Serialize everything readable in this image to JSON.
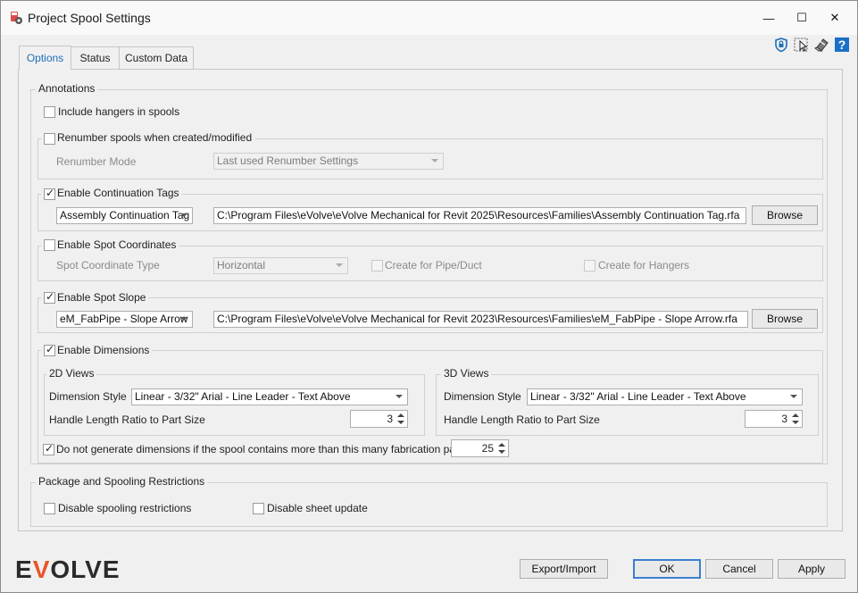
{
  "window": {
    "title": "Project Spool Settings",
    "minimize": "—",
    "maximize": "☐",
    "close": "✕"
  },
  "tabs": [
    {
      "label": "Options"
    },
    {
      "label": "Status"
    },
    {
      "label": "Custom Data"
    }
  ],
  "annotations": {
    "legend": "Annotations",
    "include_hangers": {
      "label": "Include hangers in spools",
      "checked": false
    },
    "renumber": {
      "label": "Renumber spools when created/modified",
      "checked": false,
      "mode_label": "Renumber Mode",
      "mode_value": "Last used Renumber Settings"
    },
    "continuation": {
      "label": "Enable Continuation Tags",
      "checked": true,
      "family_value": "Assembly Continuation Tag",
      "path": "C:\\Program Files\\eVolve\\eVolve Mechanical for Revit 2025\\Resources\\Families\\Assembly Continuation Tag.rfa",
      "browse": "Browse"
    },
    "spot_coordinates": {
      "label": "Enable Spot Coordinates",
      "checked": false,
      "type_label": "Spot Coordinate Type",
      "type_value": "Horizontal",
      "pipe_duct_label": "Create for Pipe/Duct",
      "hangers_label": "Create for Hangers"
    },
    "spot_slope": {
      "label": "Enable Spot Slope",
      "checked": true,
      "family_value": "eM_FabPipe - Slope Arrow",
      "path": "C:\\Program Files\\eVolve\\eVolve Mechanical for Revit 2023\\Resources\\Families\\eM_FabPipe - Slope Arrow.rfa",
      "browse": "Browse"
    },
    "dimensions": {
      "label": "Enable Dimensions",
      "checked": true,
      "views_2d": {
        "legend": "2D Views",
        "style_label": "Dimension Style",
        "style_value": "Linear - 3/32\" Arial - Line Leader - Text Above",
        "ratio_label": "Handle Length Ratio to Part Size",
        "ratio_value": "3"
      },
      "views_3d": {
        "legend": "3D Views",
        "style_label": "Dimension Style",
        "style_value": "Linear - 3/32\" Arial - Line Leader - Text Above",
        "ratio_label": "Handle Length Ratio to Part Size",
        "ratio_value": "3"
      },
      "limit_label": "Do not generate dimensions if the spool contains more than this many fabrication parts:",
      "limit_checked": true,
      "limit_value": "25"
    }
  },
  "restrictions": {
    "legend": "Package and Spooling Restrictions",
    "disable_spooling": {
      "label": "Disable spooling restrictions",
      "checked": false
    },
    "disable_sheet": {
      "label": "Disable sheet update",
      "checked": false
    }
  },
  "footer": {
    "logo": "EVOLVE",
    "export_import": "Export/Import",
    "ok": "OK",
    "cancel": "Cancel",
    "apply": "Apply"
  },
  "toolbar_icons": [
    "shield-icon",
    "cursor-select-icon",
    "eraser-icon",
    "help-icon"
  ],
  "colors": {
    "accent": "#1e6fb8",
    "logo_accent": "#e8552a"
  }
}
